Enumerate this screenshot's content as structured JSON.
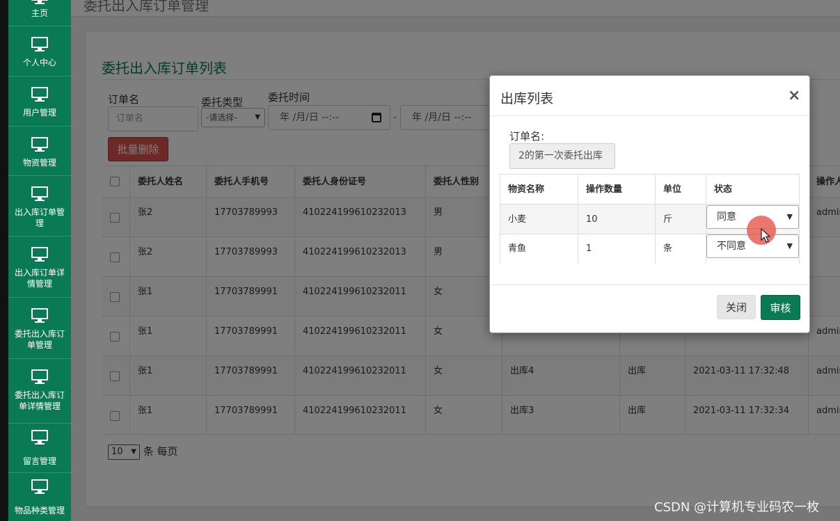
{
  "page_title": "委托出入库订单管理",
  "sidebar": {
    "items": [
      {
        "label": "主页"
      },
      {
        "label": "个人中心"
      },
      {
        "label": "用户管理"
      },
      {
        "label": "物资管理"
      },
      {
        "label": "出入库订单管理"
      },
      {
        "label": "出入库订单详情管理"
      },
      {
        "label": "委托出入库订单管理"
      },
      {
        "label": "委托出入库订单详情管理"
      },
      {
        "label": "留言管理"
      },
      {
        "label": "物品种类管理"
      }
    ]
  },
  "panel": {
    "title": "委托出入库订单列表",
    "filters": {
      "order_name_label": "订单名",
      "order_name_placeholder": "订单名",
      "type_label": "委托类型",
      "type_selected": "-请选择-",
      "time_label": "委托时间",
      "date_start": "年 /月/日 --:--",
      "date_sep": "-",
      "date_end": "年 /月/日 --:--"
    },
    "batch_delete": "批量删除",
    "table": {
      "headers": [
        "委托人姓名",
        "委托人手机号",
        "委托人身份证号",
        "委托人性别"
      ],
      "rows": [
        {
          "name": "张2",
          "phone": "17703789993",
          "id": "410224199610232013",
          "gender": "男",
          "order": "",
          "type": "",
          "time": "",
          "op": "admin"
        },
        {
          "name": "张2",
          "phone": "17703789993",
          "id": "410224199610232013",
          "gender": "男",
          "order": "",
          "type": "",
          "time": "",
          "op": ""
        },
        {
          "name": "张1",
          "phone": "17703789991",
          "id": "410224199610232011",
          "gender": "女",
          "order": "",
          "type": "",
          "time": "",
          "op": ""
        },
        {
          "name": "张1",
          "phone": "17703789991",
          "id": "410224199610232011",
          "gender": "女",
          "order": "",
          "type": "",
          "time": "",
          "op": "admin"
        },
        {
          "name": "张1",
          "phone": "17703789991",
          "id": "410224199610232011",
          "gender": "女",
          "order": "出库4",
          "type": "出库",
          "time": "2021-03-11 17:32:48",
          "op": "admin"
        },
        {
          "name": "张1",
          "phone": "17703789991",
          "id": "410224199610232011",
          "gender": "女",
          "order": "出库3",
          "type": "出库",
          "time": "2021-03-11 17:32:34",
          "op": "admin"
        }
      ],
      "op_header": "操作人"
    },
    "pager": {
      "page_size": "10",
      "suffix": "条 每页"
    }
  },
  "modal": {
    "title": "出库列表",
    "close_symbol": "×",
    "order_label": "订单名:",
    "order_value": "2的第一次委托出库",
    "table": {
      "headers": [
        "物资名称",
        "操作数量",
        "单位",
        "状态"
      ],
      "rows": [
        {
          "name": "小麦",
          "qty": "10",
          "unit": "斤",
          "status": "同意"
        },
        {
          "name": "青鱼",
          "qty": "1",
          "unit": "条",
          "status": "不同意"
        }
      ]
    },
    "close_button": "关闭",
    "audit_button": "审核"
  },
  "watermark": "CSDN @计算机专业码农一枚"
}
